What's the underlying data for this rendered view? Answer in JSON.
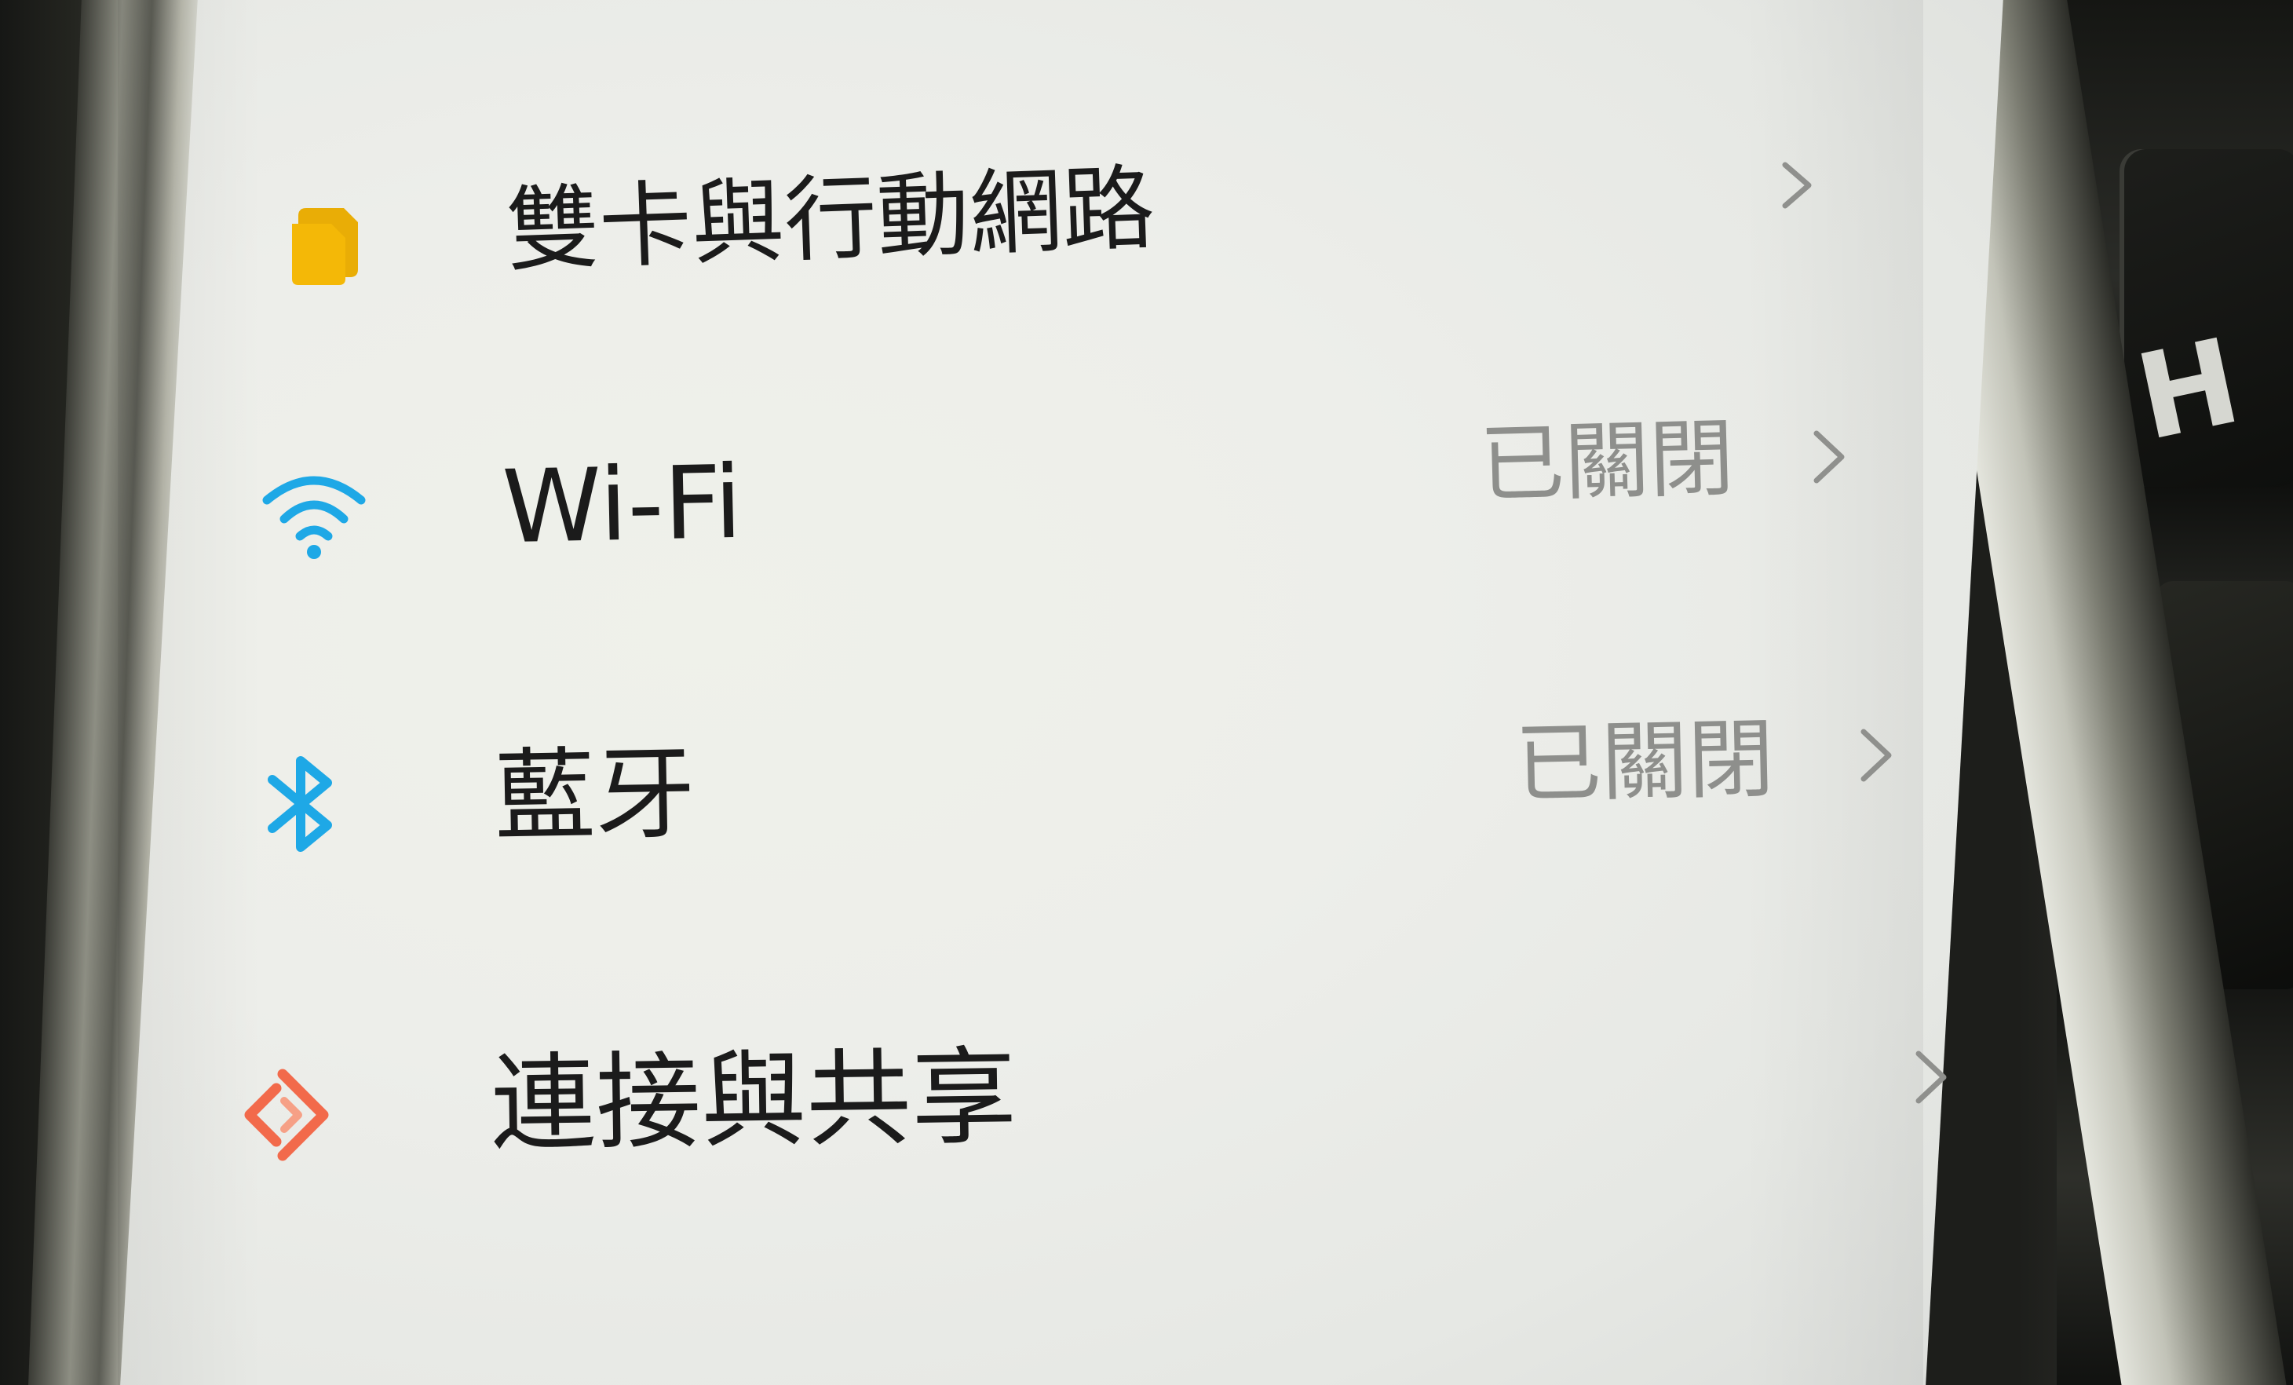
{
  "settings": {
    "items": [
      {
        "label": "雙卡與行動網路",
        "status": "",
        "icon": "sim-card-icon",
        "icon_color": "#f2b705"
      },
      {
        "label": "Wi-Fi",
        "status": "已關閉",
        "icon": "wifi-icon",
        "icon_color": "#1ea8e6"
      },
      {
        "label": "藍牙",
        "status": "已關閉",
        "icon": "bluetooth-icon",
        "icon_color": "#1ea8e6"
      },
      {
        "label": "連接與共享",
        "status": "",
        "icon": "connection-sharing-icon",
        "icon_color": "#f26a4b"
      }
    ]
  },
  "background": {
    "keyboard_key_label": "H"
  }
}
